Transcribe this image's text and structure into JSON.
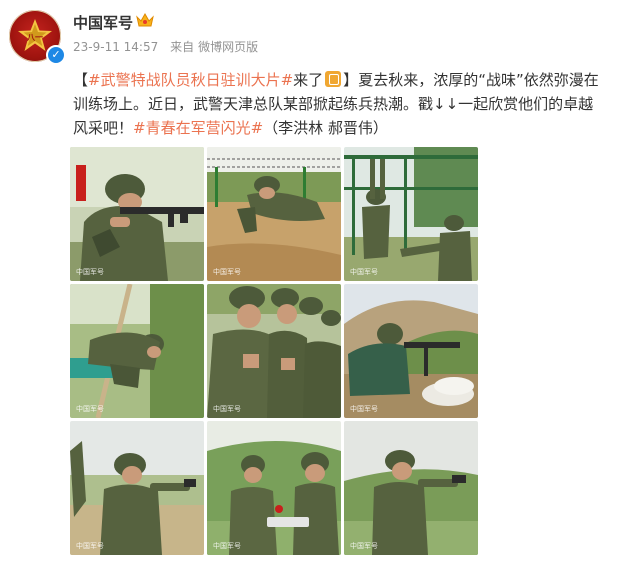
{
  "account": {
    "name": "中国军号",
    "time": "23-9-11 14:57",
    "source_prefix": "来自",
    "source": "微博网页版"
  },
  "post": {
    "bracket_open": "【",
    "headline_tag": "#武警特战队员秋日驻训大片#",
    "headline_suffix": "来了",
    "bracket_close": "】",
    "body": "夏去秋来，浓厚的“战味”依然弥漫在训练场上。近日，武警天津总队某部掀起练兵热潮。戳↓↓一起欣赏他们的卓越风采吧！",
    "topic_tag": "#青春在军营闪光#",
    "credit": "（李洪林 郝晋伟）"
  },
  "images": [
    {
      "caption": "soldier-aiming-rifle"
    },
    {
      "caption": "soldier-crawling-under-wire"
    },
    {
      "caption": "soldiers-on-monkey-bars"
    },
    {
      "caption": "soldier-rope-climbing"
    },
    {
      "caption": "soldiers-in-formation"
    },
    {
      "caption": "soldier-firing-from-cover"
    },
    {
      "caption": "soldier-pistol-firing"
    },
    {
      "caption": "instructor-and-soldier"
    },
    {
      "caption": "soldier-pistol-aiming"
    }
  ],
  "watermark": "中国军号",
  "colors": {
    "tag": "#eb7350",
    "brand_red": "#c4231f",
    "verified": "#1e88e5",
    "meta": "#939393"
  }
}
